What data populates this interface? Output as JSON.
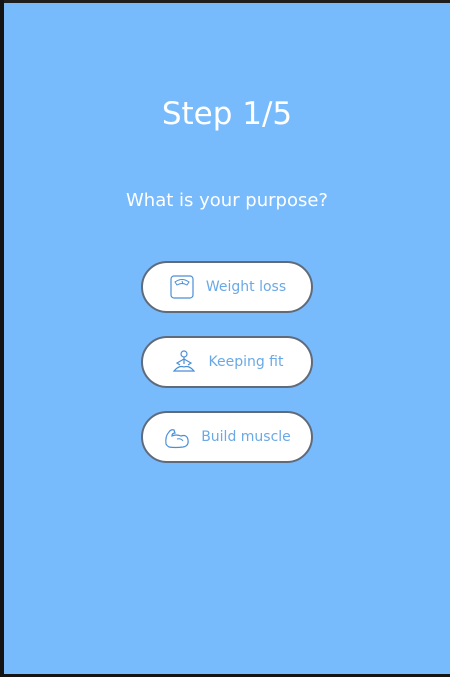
{
  "header": {
    "step": "Step 1/5",
    "question": "What is your purpose?"
  },
  "options": [
    {
      "label": "Weight loss",
      "icon": "scale-icon"
    },
    {
      "label": "Keeping fit",
      "icon": "meditation-icon"
    },
    {
      "label": "Build muscle",
      "icon": "muscle-arm-icon"
    }
  ],
  "colors": {
    "background": "#78bbfd",
    "button_bg": "#ffffff",
    "button_border": "#5f6a7a",
    "label_text": "#6aa9e6",
    "title_text": "#ffffff"
  }
}
